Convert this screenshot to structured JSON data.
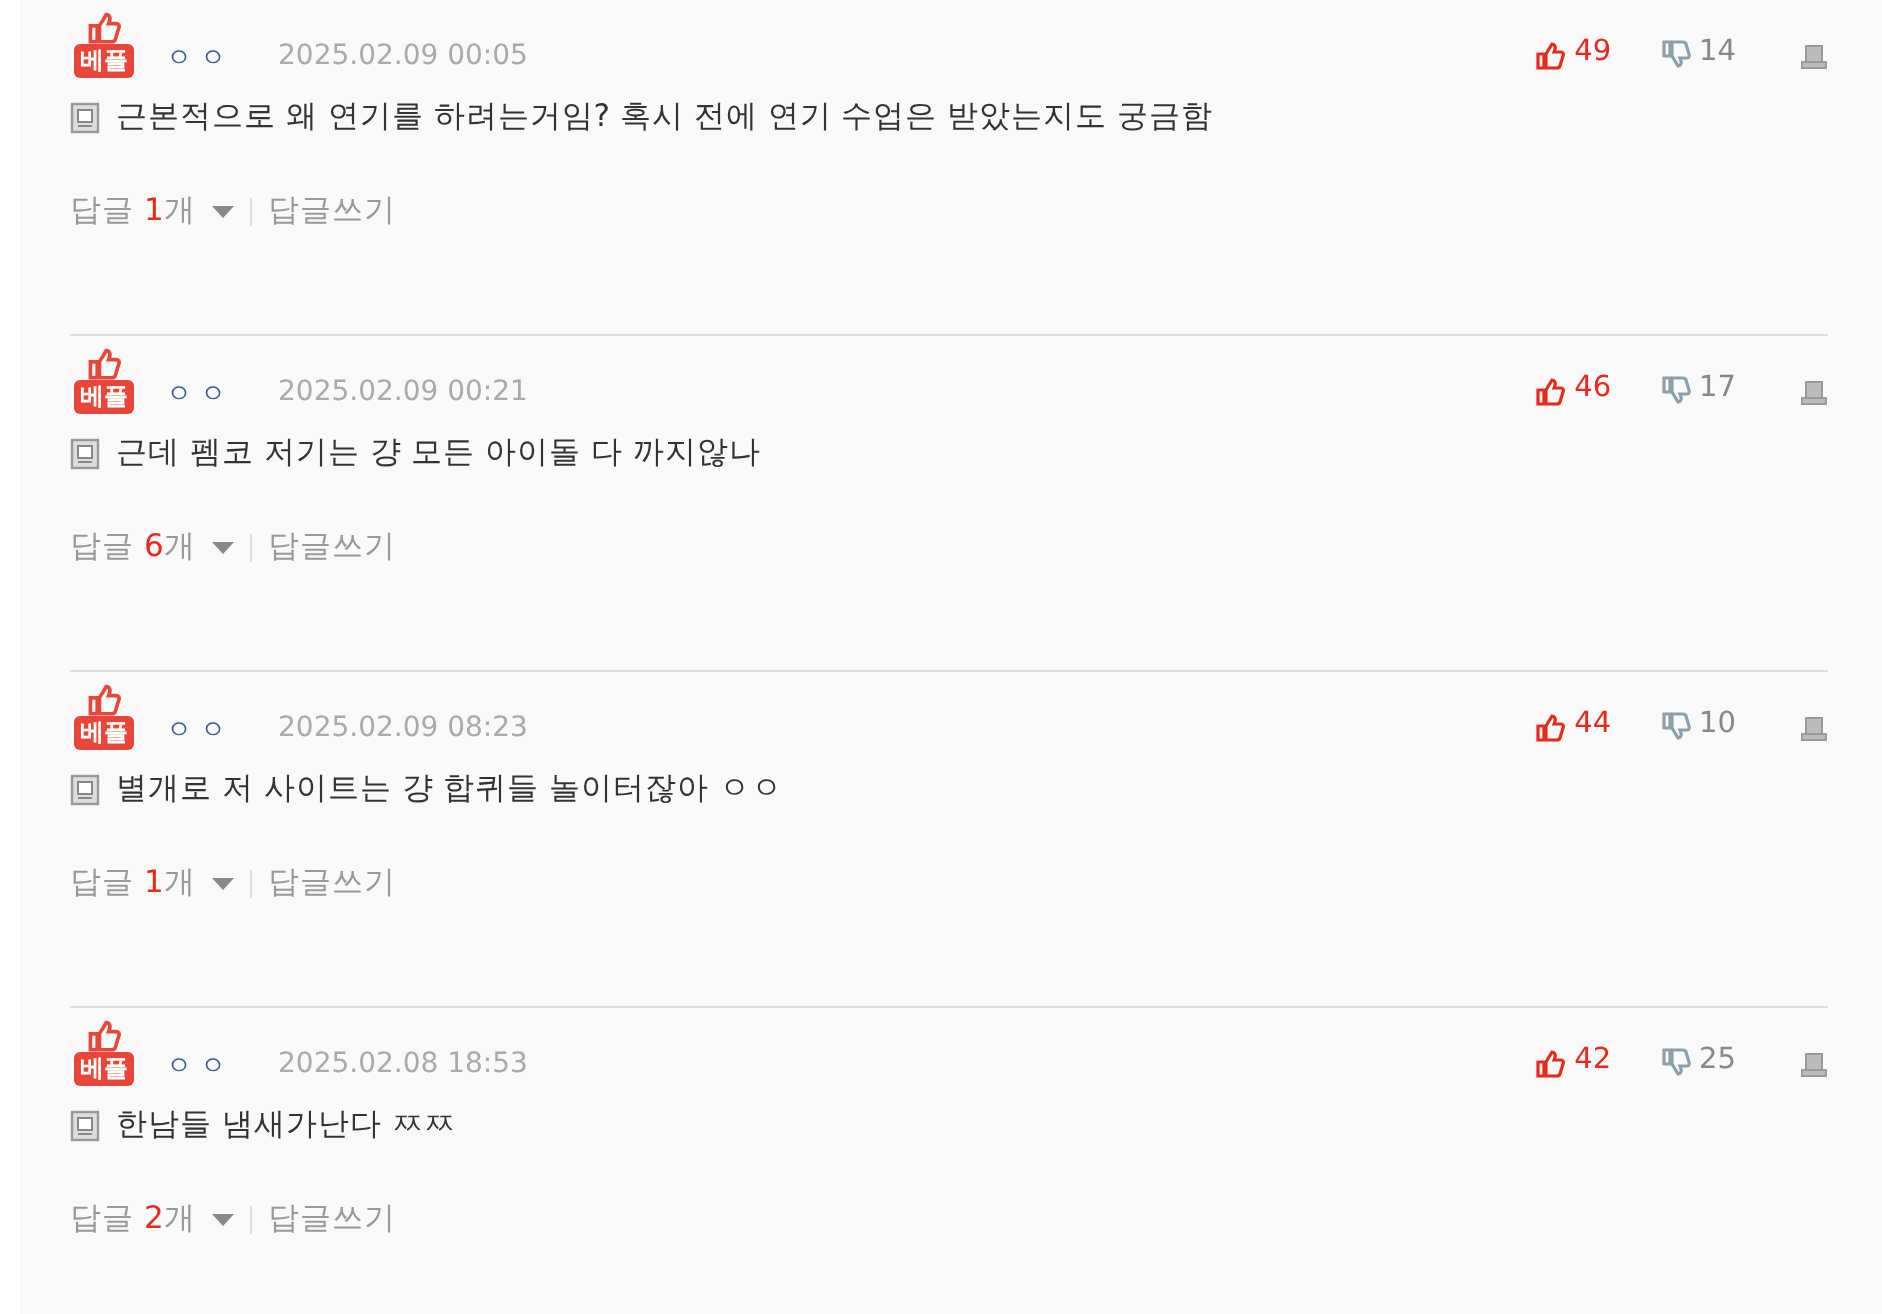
{
  "comments": [
    {
      "badge": "베플",
      "author": "ㅇㅇ",
      "date": "2025.02.09 00:05",
      "text": "근본적으로 왜 연기를 하려는거임? 혹시 전에 연기 수업은 받았는지도 궁금함",
      "likes": "49",
      "dislikes": "14",
      "reply_label": "답글",
      "reply_count": "1",
      "reply_unit": "개",
      "write_reply": "답글쓰기"
    },
    {
      "badge": "베플",
      "author": "ㅇㅇ",
      "date": "2025.02.09 00:21",
      "text": "근데 펨코 저기는 걍 모든 아이돌 다 까지않나",
      "likes": "46",
      "dislikes": "17",
      "reply_label": "답글",
      "reply_count": "6",
      "reply_unit": "개",
      "write_reply": "답글쓰기"
    },
    {
      "badge": "베플",
      "author": "ㅇㅇ",
      "date": "2025.02.09 08:23",
      "text": "별개로 저 사이트는 걍 합퀴들 놀이터잖아 ㅇㅇ",
      "likes": "44",
      "dislikes": "10",
      "reply_label": "답글",
      "reply_count": "1",
      "reply_unit": "개",
      "write_reply": "답글쓰기"
    },
    {
      "badge": "베플",
      "author": "ㅇㅇ",
      "date": "2025.02.08 18:53",
      "text": "한남들 냄새가난다 ㅉㅉ",
      "likes": "42",
      "dislikes": "25",
      "reply_label": "답글",
      "reply_count": "2",
      "reply_unit": "개",
      "write_reply": "답글쓰기"
    }
  ]
}
